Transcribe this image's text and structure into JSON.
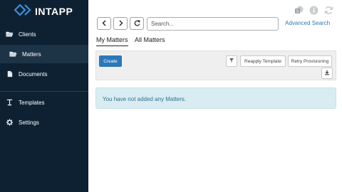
{
  "brand": {
    "name": "INTAPP",
    "logo_icon": "intapp-chevron-icon"
  },
  "sidebar": {
    "items": [
      {
        "label": "Clients",
        "icon": "folder-open-icon",
        "active": false
      },
      {
        "label": "Matters",
        "icon": "folder-open-icon",
        "active": true
      },
      {
        "label": "Documents",
        "icon": "document-icon",
        "active": false
      },
      {
        "label": "Templates",
        "icon": "template-icon",
        "active": false
      },
      {
        "label": "Settings",
        "icon": "gear-icon",
        "active": false
      }
    ]
  },
  "toolbar": {
    "back_icon": "chevron-left-icon",
    "forward_icon": "chevron-right-icon",
    "refresh_icon": "refresh-icon",
    "search_placeholder": "Search...",
    "advanced_search_label": "Advanced Search"
  },
  "top_icons": [
    "sharepoint-icon",
    "info-icon",
    "sync-icon"
  ],
  "tabs": [
    {
      "label": "My Matters",
      "active": true
    },
    {
      "label": "All Matters",
      "active": false
    }
  ],
  "actions": {
    "create_label": "Create",
    "reapply_label": "Reapply Template",
    "retry_label": "Retry Provisioning"
  },
  "notice": {
    "text": "You have not added any Matters."
  },
  "colors": {
    "sidebar_bg": "#0e2132",
    "sidebar_active": "#1d3346",
    "primary": "#2b78b9",
    "link": "#2e77b5",
    "notice_bg": "#d9ecf2",
    "notice_text": "#31708f"
  }
}
